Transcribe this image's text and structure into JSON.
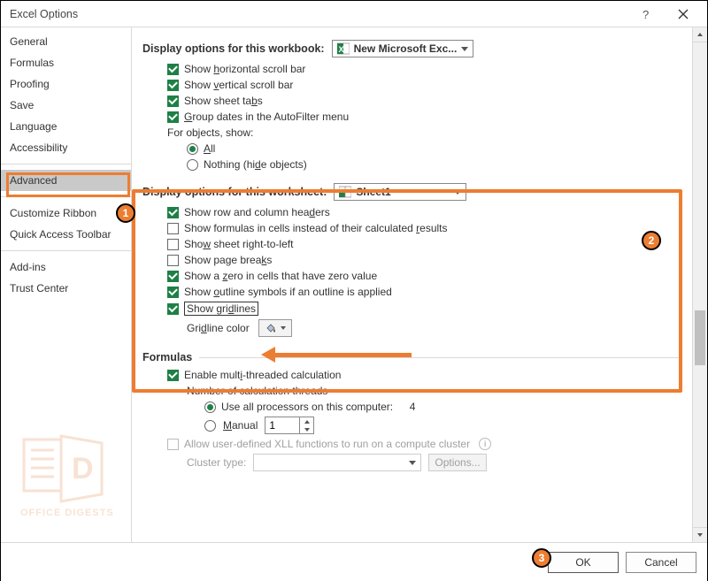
{
  "title": "Excel Options",
  "sidebar": {
    "items": [
      {
        "label": "General"
      },
      {
        "label": "Formulas"
      },
      {
        "label": "Proofing"
      },
      {
        "label": "Save"
      },
      {
        "label": "Language"
      },
      {
        "label": "Accessibility"
      },
      {
        "label": "Advanced"
      },
      {
        "label": "Customize Ribbon"
      },
      {
        "label": "Quick Access Toolbar"
      },
      {
        "label": "Add-ins"
      },
      {
        "label": "Trust Center"
      }
    ]
  },
  "section_workbook": {
    "heading": "Display options for this workbook:",
    "combo": "New Microsoft Exc...",
    "show_hscroll": "Show horizontal scroll bar",
    "show_vscroll": "Show vertical scroll bar",
    "show_tabs": "Show sheet tabs",
    "group_dates": "Group dates in the AutoFilter menu",
    "for_objects": "For objects, show:",
    "obj_all": "All",
    "obj_nothing": "Nothing (hide objects)"
  },
  "section_worksheet": {
    "heading": "Display options for this worksheet:",
    "combo": "Sheet1",
    "row_col_headers": "Show row and column headers",
    "show_formulas": "Show formulas in cells instead of their calculated results",
    "rtl": "Show sheet right-to-left",
    "page_breaks": "Show page breaks",
    "zero": "Show a zero in cells that have zero value",
    "outline": "Show outline symbols if an outline is applied",
    "gridlines": "Show gridlines",
    "gridline_color_label": "Gridline color"
  },
  "section_formulas": {
    "heading": "Formulas",
    "multi_thread": "Enable multi-threaded calculation",
    "num_threads_label": "Number of calculation threads",
    "use_all": "Use all processors on this computer:",
    "proc_count": "4",
    "manual": "Manual",
    "manual_val": "1",
    "xll": "Allow user-defined XLL functions to run on a compute cluster",
    "cluster_type": "Cluster type:",
    "options_btn": "Options..."
  },
  "footer": {
    "ok": "OK",
    "cancel": "Cancel"
  }
}
